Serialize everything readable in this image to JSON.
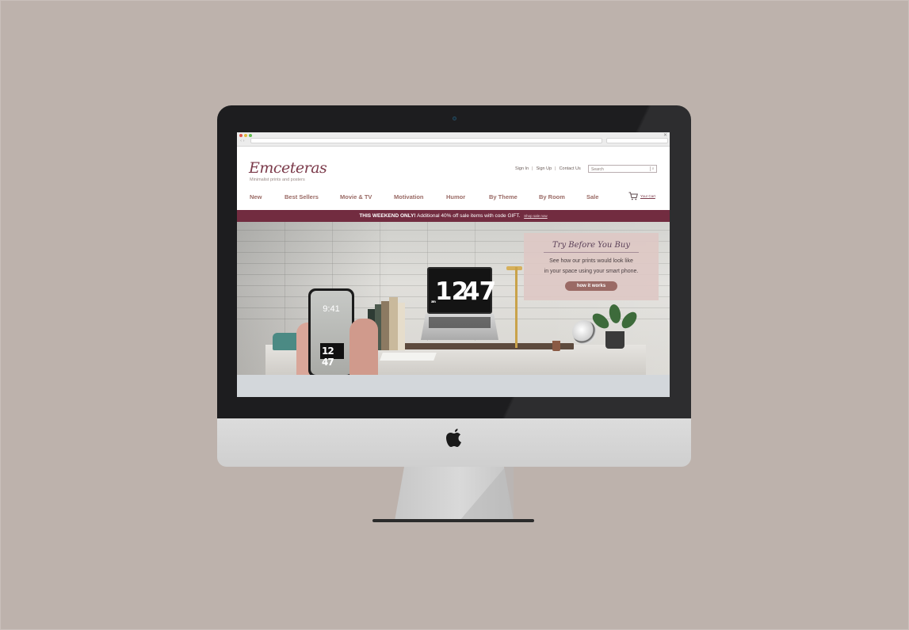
{
  "site": {
    "logo": "Emceteras",
    "tagline": "Minimalist prints and posters",
    "util_links": [
      "Sign In",
      "Sign Up",
      "Contact Us"
    ],
    "search_placeholder": "Search",
    "nav": [
      "New",
      "Best Sellers",
      "Movie & TV",
      "Motivation",
      "Humor",
      "By Theme",
      "By Room",
      "Sale"
    ],
    "cart_label": "Your Cart"
  },
  "promo": {
    "bold": "THIS WEEKEND ONLY!",
    "text": "Additional 40% off sale items with code GIFT.",
    "link": "Shop sale now"
  },
  "hero": {
    "title": "Try Before You Buy",
    "line1": "See how our prints would look like",
    "line2": "in your space using your smart phone.",
    "button": "how it works",
    "laptop_clock_hour": "12",
    "laptop_clock_min": "47",
    "laptop_clock_am": "am",
    "phone_time": "9:41",
    "phone_clock": "12 47"
  },
  "colors": {
    "background": "#bdb2ac",
    "brand": "#7b3a4a",
    "promo_bar": "#722c40",
    "nav_text": "#9a6a65",
    "cta_button": "#9a6a65"
  }
}
